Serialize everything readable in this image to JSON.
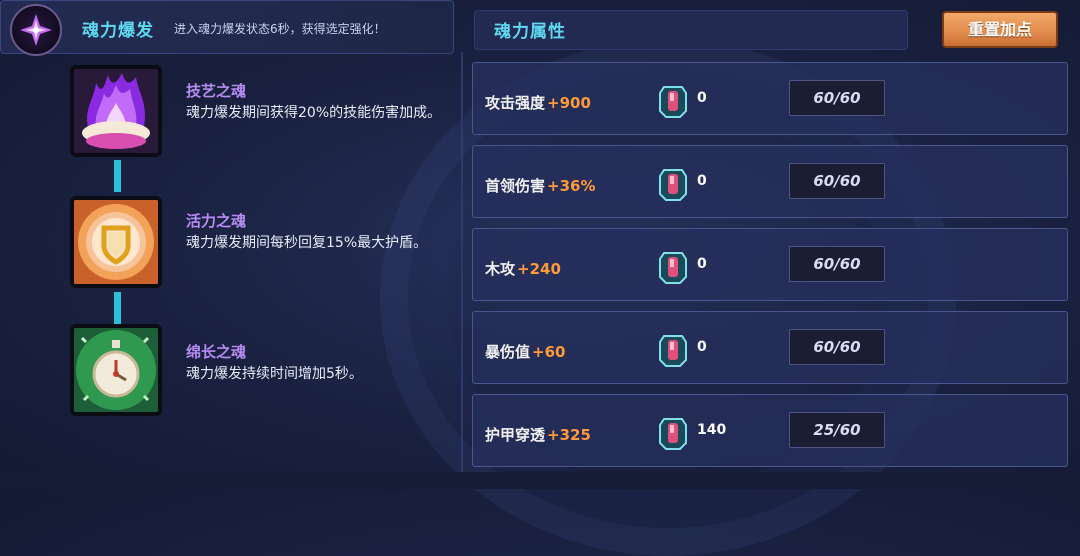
{
  "header": {
    "title": "魂力爆发",
    "description": "进入魂力爆发状态6秒，获得选定强化！",
    "attr_title": "魂力属性",
    "reset_label": "重置加点"
  },
  "skills": [
    {
      "name": "技艺之魂",
      "desc": "魂力爆发期间获得20%的技能伤害加成。",
      "icon": "purple-flame-shell-icon"
    },
    {
      "name": "活力之魂",
      "desc": "魂力爆发期间每秒回复15%最大护盾。",
      "icon": "shield-sun-icon"
    },
    {
      "name": "绵长之魂",
      "desc": "魂力爆发持续时间增加5秒。",
      "icon": "stopwatch-icon"
    }
  ],
  "attributes": [
    {
      "label": "攻击强度",
      "bonus": "+900",
      "gems": "0",
      "level": "60/60"
    },
    {
      "label": "首领伤害",
      "bonus": "+36%",
      "gems": "0",
      "level": "60/60"
    },
    {
      "label": "木攻",
      "bonus": "+240",
      "gems": "0",
      "level": "60/60"
    },
    {
      "label": "暴伤值",
      "bonus": "+60",
      "gems": "0",
      "level": "60/60"
    },
    {
      "label": "护甲穿透",
      "bonus": "+325",
      "gems": "140",
      "level": "25/60"
    }
  ],
  "colors": {
    "accent_cyan": "#5fd8f0",
    "skill_name_purple": "#b78cf2",
    "bonus_orange": "#ff9a3a",
    "reset_button": "#e18a4a"
  }
}
